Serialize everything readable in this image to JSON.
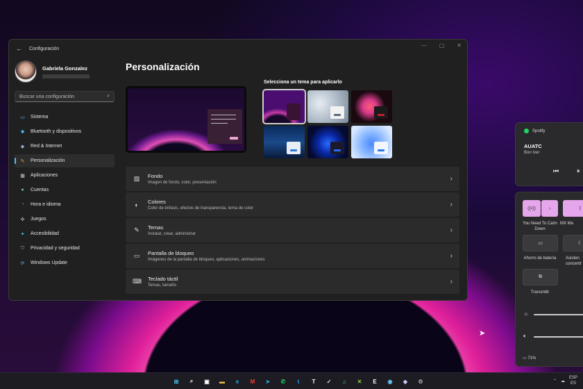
{
  "window": {
    "title": "Configuración",
    "controls": [
      "—",
      "▢",
      "✕"
    ]
  },
  "profile": {
    "name": "Gabriela Gonzalez"
  },
  "search": {
    "placeholder": "Buscar una configuración",
    "icon": "search-icon"
  },
  "sidebar": {
    "items": [
      {
        "label": "Sistema",
        "icon": "system-icon",
        "color": "#4cc2ff"
      },
      {
        "label": "Bluetooth y dispositivos",
        "icon": "bluetooth-icon",
        "color": "#4cc2ff"
      },
      {
        "label": "Red & Internet",
        "icon": "network-icon",
        "color": "#9ab0d0"
      },
      {
        "label": "Personalización",
        "icon": "brush-icon",
        "color": "#f0a040",
        "active": true
      },
      {
        "label": "Aplicaciones",
        "icon": "apps-icon",
        "color": "#c0c8d8"
      },
      {
        "label": "Cuentas",
        "icon": "accounts-icon",
        "color": "#5cd0b0"
      },
      {
        "label": "Hora e idioma",
        "icon": "time-language-icon",
        "color": "#4cc2ff"
      },
      {
        "label": "Juegos",
        "icon": "gaming-icon",
        "color": "#b0b8c8"
      },
      {
        "label": "Accesibilidad",
        "icon": "accessibility-icon",
        "color": "#4cc2ff"
      },
      {
        "label": "Privacidad y seguridad",
        "icon": "shield-icon",
        "color": "#9aa0aa"
      },
      {
        "label": "Windows Update",
        "icon": "update-icon",
        "color": "#4cc2ff"
      }
    ]
  },
  "main": {
    "title": "Personalización",
    "theme_label": "Selecciona un tema para aplicarlo",
    "rows": [
      {
        "title": "Fondo",
        "subtitle": "Imagen de fondo, color, presentación",
        "icon": "image-icon"
      },
      {
        "title": "Colores",
        "subtitle": "Color de énfasis, efectos de transparencia, tema de color",
        "icon": "palette-icon"
      },
      {
        "title": "Temas",
        "subtitle": "Instalar, crear, administrar",
        "icon": "pen-icon"
      },
      {
        "title": "Pantalla de bloqueo",
        "subtitle": "Imágenes de la pantalla de bloqueo, aplicaciones, animaciones",
        "icon": "lock-screen-icon"
      },
      {
        "title": "Teclado táctil",
        "subtitle": "Temas, tamaño",
        "icon": "keyboard-icon"
      }
    ]
  },
  "media": {
    "app": "Spotify",
    "track": "AUATC",
    "artist": "Bon Iver"
  },
  "quick": {
    "wifi_label": "You Need To Calm Down",
    "bt_label": "MX Ma",
    "battery_saver_label": "Ahorro de batería",
    "focus_label": "Asisten concentr",
    "cast_label": "Transmitir",
    "brightness": 0.7,
    "volume": 0.7,
    "battery": "71%"
  },
  "taskbar": {
    "language_top": "ESP",
    "language_bottom": "ES",
    "apps": [
      {
        "icon": "windows-start-icon",
        "glyph": "⊞",
        "color": "#4cc2ff"
      },
      {
        "icon": "search-icon",
        "glyph": "⌕",
        "color": "#ffffff"
      },
      {
        "icon": "task-view-icon",
        "glyph": "▣",
        "color": "#ffffff"
      },
      {
        "icon": "file-explorer-icon",
        "glyph": "▬",
        "color": "#f5c542"
      },
      {
        "icon": "edge-icon",
        "glyph": "e",
        "color": "#2aa6e0"
      },
      {
        "icon": "gmail-icon",
        "glyph": "M",
        "color": "#ea4335"
      },
      {
        "icon": "telegram-icon",
        "glyph": "➤",
        "color": "#2aa1da"
      },
      {
        "icon": "whatsapp-icon",
        "glyph": "✆",
        "color": "#25d366"
      },
      {
        "icon": "twitter-icon",
        "glyph": "t",
        "color": "#1da1f2"
      },
      {
        "icon": "typora-icon",
        "glyph": "T",
        "color": "#ffffff"
      },
      {
        "icon": "tweetdeck-icon",
        "glyph": "✓",
        "color": "#e8e8e8"
      },
      {
        "icon": "spotify-icon",
        "glyph": "♫",
        "color": "#1ed760"
      },
      {
        "icon": "xbox-icon",
        "glyph": "✕",
        "color": "#9ad04a"
      },
      {
        "icon": "epic-games-icon",
        "glyph": "E",
        "color": "#ffffff"
      },
      {
        "icon": "steam-icon",
        "glyph": "◉",
        "color": "#66c0f4"
      },
      {
        "icon": "app-icon",
        "glyph": "◈",
        "color": "#d0d8ff"
      },
      {
        "icon": "settings-icon",
        "glyph": "⚙",
        "color": "#a0a8b8"
      }
    ]
  }
}
